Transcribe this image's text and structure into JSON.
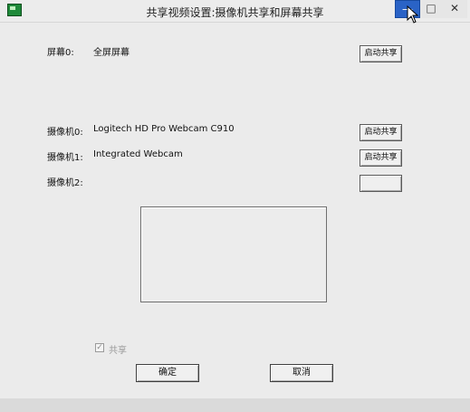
{
  "window": {
    "title": "共享视频设置:摄像机共享和屏幕共享",
    "minimize_glyph": "—",
    "maximize_glyph": "□",
    "close_glyph": "✕"
  },
  "screen": {
    "label": "屏幕0:",
    "device": "全屏屏幕",
    "button": "启动共享"
  },
  "cameras": [
    {
      "label": "摄像机0:",
      "device": "Logitech HD Pro Webcam C910",
      "button": "启动共享"
    },
    {
      "label": "摄像机1:",
      "device": "Integrated Webcam",
      "button": "启动共享"
    },
    {
      "label": "摄像机2:",
      "device": "",
      "button": ""
    }
  ],
  "share_checkbox": {
    "label": "共享",
    "checked": true,
    "mark": "✓"
  },
  "buttons": {
    "ok": "确定",
    "cancel": "取消"
  },
  "colors": {
    "minimize_active": "#2a63c6",
    "app_icon": "#1f8a3a"
  }
}
